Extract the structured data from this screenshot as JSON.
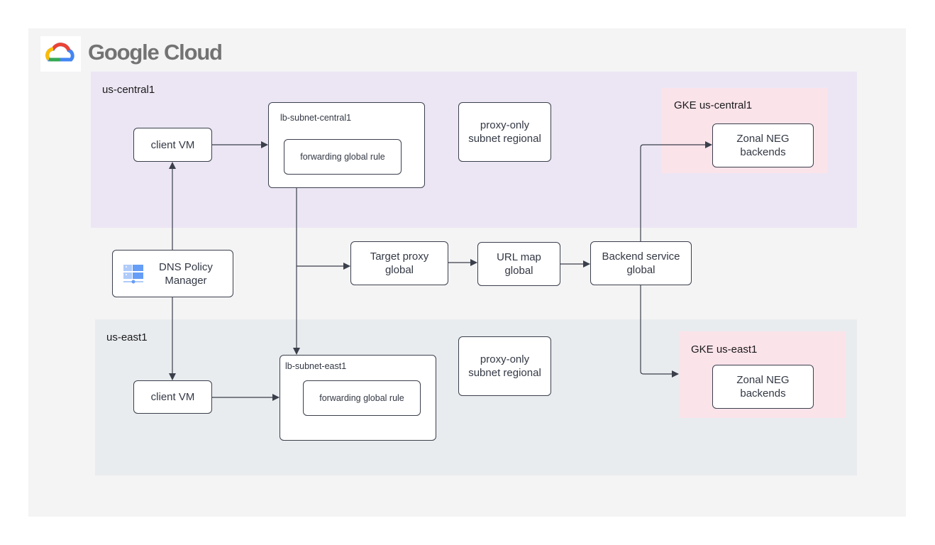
{
  "brand": {
    "name": "Google Cloud",
    "logo_icon": "google-cloud-logo-icon"
  },
  "regions": {
    "central": {
      "label": "us-central1",
      "color": "#ece6f4"
    },
    "east": {
      "label": "us-east1",
      "color": "#e9ecef"
    },
    "gke_central": {
      "label": "GKE us-central1",
      "color": "#fbe3ea"
    },
    "gke_east": {
      "label": "GKE us-east1",
      "color": "#fbe3ea"
    }
  },
  "nodes": {
    "client_vm_central": "client VM",
    "client_vm_east": "client VM",
    "lb_subnet_central": "lb-subnet-central1",
    "lb_subnet_east": "lb-subnet-east1",
    "fwd_rule_central": "forwarding global rule",
    "fwd_rule_east": "forwarding global rule",
    "proxy_only_central": [
      "proxy-only",
      "subnet regional"
    ],
    "proxy_only_east": [
      "proxy-only",
      "subnet regional"
    ],
    "dns_policy_manager": [
      "DNS Policy",
      "Manager"
    ],
    "dns_icon": "dns-server-icon",
    "target_proxy": [
      "Target proxy",
      "global"
    ],
    "url_map": [
      "URL map",
      "global"
    ],
    "backend_service": [
      "Backend service",
      "global"
    ],
    "neg_central": [
      "Zonal NEG",
      "backends"
    ],
    "neg_east": [
      "Zonal NEG",
      "backends"
    ]
  },
  "edges": [
    {
      "from": "dns_policy_manager",
      "to": "client_vm_central"
    },
    {
      "from": "dns_policy_manager",
      "to": "client_vm_east"
    },
    {
      "from": "client_vm_central",
      "to": "lb_subnet_central"
    },
    {
      "from": "client_vm_east",
      "to": "lb_subnet_east"
    },
    {
      "from": "lb_subnet_central",
      "to": "lb_subnet_east"
    },
    {
      "from": "lb_subnet_central",
      "to": "target_proxy"
    },
    {
      "from": "target_proxy",
      "to": "url_map"
    },
    {
      "from": "url_map",
      "to": "backend_service"
    },
    {
      "from": "backend_service",
      "to": "neg_central"
    },
    {
      "from": "backend_service",
      "to": "gke_east"
    }
  ],
  "colors": {
    "line": "#3a3f4b",
    "canvas": "#f4f4f5"
  }
}
